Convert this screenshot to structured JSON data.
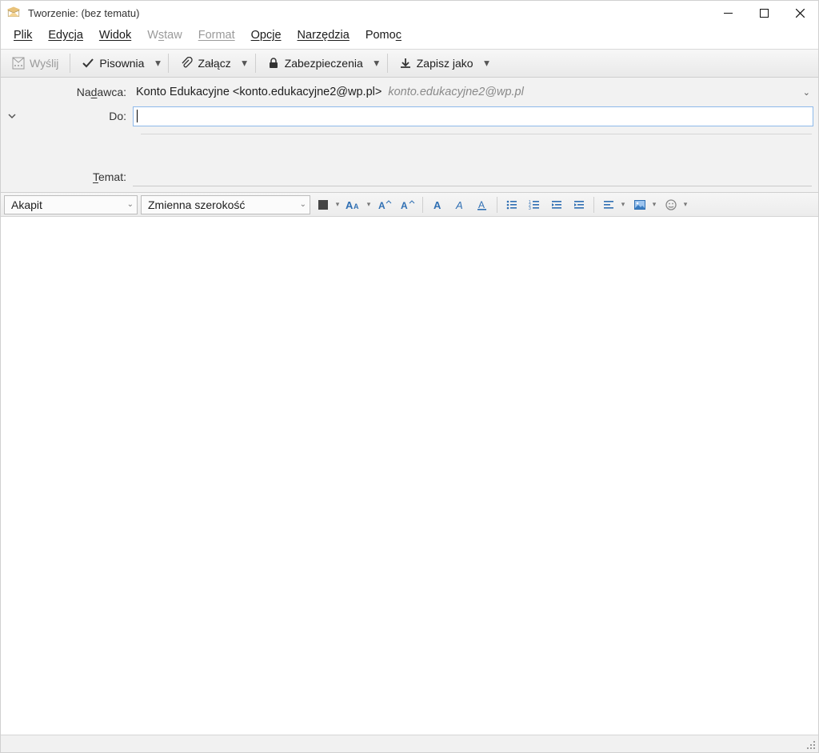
{
  "window": {
    "title": "Tworzenie: (bez tematu)"
  },
  "menu": {
    "file": "Plik",
    "edit": "Edycja",
    "view": "Widok",
    "insert": "Wstaw",
    "format": "Format",
    "options": "Opcje",
    "tools": "Narzędzia",
    "help": "Pomoc"
  },
  "toolbar": {
    "send": "Wyślij",
    "spelling": "Pisownia",
    "attach": "Załącz",
    "security": "Zabezpieczenia",
    "save_as": "Zapisz jako"
  },
  "headers": {
    "from_label": "Nadawca:",
    "from_display": "Konto Edukacyjne <konto.edukacyjne2@wp.pl>",
    "from_identity": "konto.edukacyjne2@wp.pl",
    "to_label": "Do:",
    "to_value": "",
    "subject_label": "Temat:",
    "subject_value": ""
  },
  "format_toolbar": {
    "paragraph_style": "Akapit",
    "font_family": "Zmienna szerokość"
  }
}
